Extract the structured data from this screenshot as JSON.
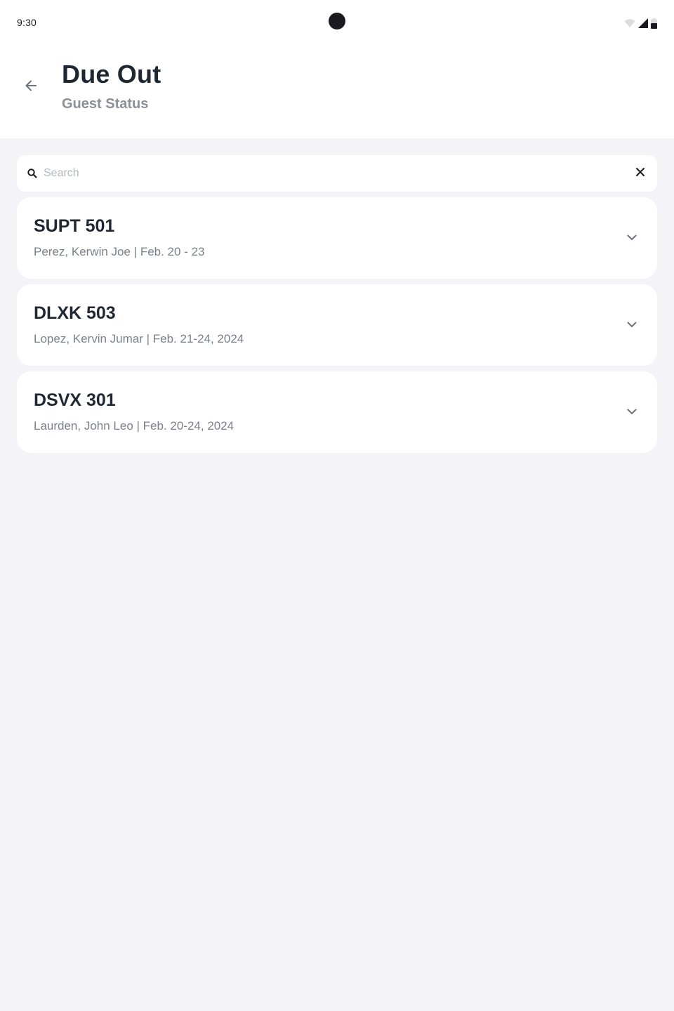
{
  "status_bar": {
    "time": "9:30"
  },
  "header": {
    "title": "Due Out",
    "subtitle": "Guest Status",
    "back_icon": "arrow-left-icon"
  },
  "search": {
    "placeholder": "Search",
    "value": "",
    "icon": "search-icon",
    "clear_icon": "close-icon"
  },
  "rooms": [
    {
      "code": "SUPT 501",
      "detail": "Perez, Kerwin Joe | Feb. 20 - 23"
    },
    {
      "code": "DLXK 503",
      "detail": "Lopez, Kervin Jumar | Feb. 21-24, 2024"
    },
    {
      "code": "DSVX 301",
      "detail": "Laurden, John Leo | Feb. 20-24, 2024"
    }
  ],
  "colors": {
    "background": "#f3f3f8",
    "surface": "#ffffff",
    "title_text": "#1f2733",
    "secondary_text": "#7c8089",
    "subtitle_text": "#8a8f98"
  }
}
